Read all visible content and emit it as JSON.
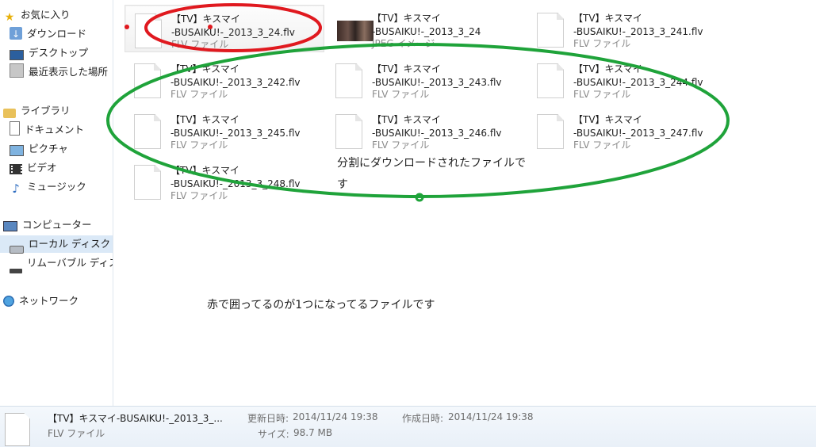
{
  "nav": {
    "favorites": "お気に入り",
    "downloads": "ダウンロード",
    "desktop": "デスクトップ",
    "recent": "最近表示した場所",
    "libraries": "ライブラリ",
    "documents": "ドキュメント",
    "pictures": "ピクチャ",
    "videos": "ビデオ",
    "music": "ミュージック",
    "computer": "コンピューター",
    "local_disk": "ローカル ディスク (",
    "removable": "リムーバブル ディス",
    "network": "ネットワーク"
  },
  "files": [
    {
      "l1": "【TV】キスマイ",
      "l2": "-BUSAIKU!-_2013_3_24.flv",
      "l3": "FLV ファイル"
    },
    {
      "l1": "【TV】キスマイ",
      "l2": "-BUSAIKU!-_2013_3_24",
      "l3": "JPEG イメージ"
    },
    {
      "l1": "【TV】キスマイ",
      "l2": "-BUSAIKU!-_2013_3_241.flv",
      "l3": "FLV ファイル"
    },
    {
      "l1": "【TV】キスマイ",
      "l2": "-BUSAIKU!-_2013_3_242.flv",
      "l3": "FLV ファイル"
    },
    {
      "l1": "【TV】キスマイ",
      "l2": "-BUSAIKU!-_2013_3_243.flv",
      "l3": "FLV ファイル"
    },
    {
      "l1": "【TV】キスマイ",
      "l2": "-BUSAIKU!-_2013_3_244.flv",
      "l3": "FLV ファイル"
    },
    {
      "l1": "【TV】キスマイ",
      "l2": "-BUSAIKU!-_2013_3_245.flv",
      "l3": "FLV ファイル"
    },
    {
      "l1": "【TV】キスマイ",
      "l2": "-BUSAIKU!-_2013_3_246.flv",
      "l3": "FLV ファイル"
    },
    {
      "l1": "【TV】キスマイ",
      "l2": "-BUSAIKU!-_2013_3_247.flv",
      "l3": "FLV ファイル"
    },
    {
      "l1": "【TV】キスマイ",
      "l2": "-BUSAIKU!-_2013_3_248.flv",
      "l3": "FLV ファイル"
    }
  ],
  "notes": {
    "split_line1": "分割にダウンロードされたファイルで",
    "split_line2": "す",
    "combined": "赤で囲ってるのが1つになってるファイルです"
  },
  "details": {
    "name": "【TV】キスマイ-BUSAIKU!-_2013_3_...",
    "type": "FLV ファイル",
    "modified_label": "更新日時:",
    "modified_value": "2014/11/24 19:38",
    "created_label": "作成日時:",
    "created_value": "2014/11/24 19:38",
    "size_label": "サイズ:",
    "size_value": "98.7 MB"
  },
  "colors": {
    "annotation_red": "#e0191f",
    "annotation_green": "#1fa33a"
  }
}
